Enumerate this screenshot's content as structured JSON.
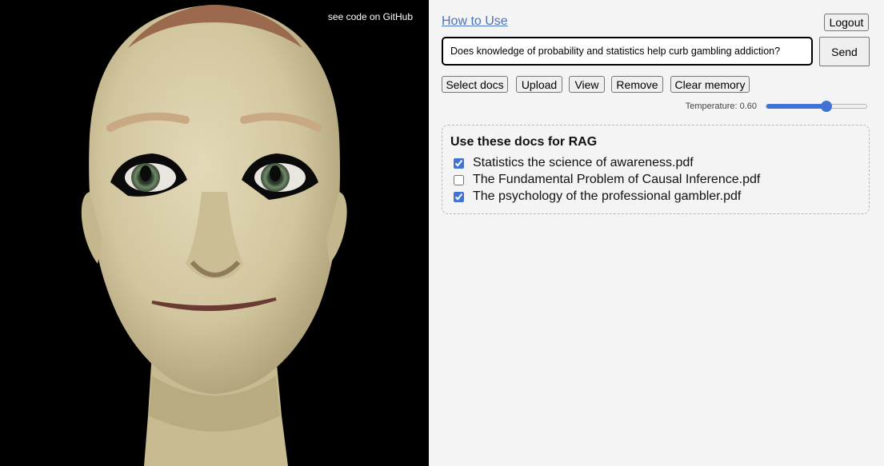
{
  "avatar": {
    "github_link": "see code on GitHub"
  },
  "header": {
    "how_to_use": "How to Use",
    "logout_label": "Logout"
  },
  "query": {
    "value": "Does knowledge of probability and statistics help curb gambling addiction?",
    "send_label": "Send"
  },
  "toolbar": {
    "select_docs": "Select docs",
    "upload": "Upload",
    "view": "View",
    "remove": "Remove",
    "clear_memory": "Clear memory"
  },
  "temperature": {
    "label": "Temperature: 0.60",
    "value": 0.6,
    "min": 0,
    "max": 1
  },
  "rag": {
    "title": "Use these docs for RAG",
    "docs": [
      {
        "name": "Statistics the science of awareness.pdf",
        "checked": true
      },
      {
        "name": "The Fundamental Problem of Causal Inference.pdf",
        "checked": false
      },
      {
        "name": "The psychology of the professional gambler.pdf",
        "checked": true
      }
    ]
  },
  "colors": {
    "accent": "#3f73d4",
    "link": "#4a74b8",
    "avatar_bg": "#000000",
    "skin": "#d9cfab"
  }
}
